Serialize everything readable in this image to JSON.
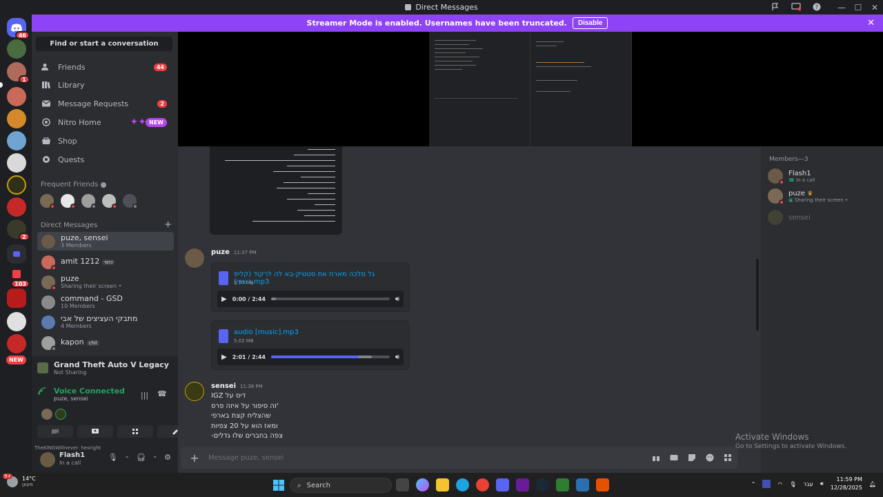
{
  "window": {
    "title": "Direct Messages",
    "controls": [
      "—",
      "☐",
      "✕"
    ]
  },
  "banner": {
    "text": "Streamer Mode is enabled. Usernames have been truncated.",
    "button": "Disable",
    "close": "✕"
  },
  "servers": {
    "badges": [
      "46",
      "1",
      "2",
      "103"
    ],
    "new_label": "NEW"
  },
  "dm_panel": {
    "find": "Find or start a conversation",
    "nav": [
      {
        "label": "Friends",
        "badge": "44"
      },
      {
        "label": "Library",
        "badge": ""
      },
      {
        "label": "Message Requests",
        "badge": "2"
      },
      {
        "label": "Nitro Home",
        "pill": "NEW"
      },
      {
        "label": "Shop",
        "badge": ""
      },
      {
        "label": "Quests",
        "badge": ""
      }
    ],
    "frequent_friends": "Frequent Friends",
    "direct_messages": "Direct Messages",
    "add": "+",
    "dms": [
      {
        "name": "puze, sensei",
        "sub": "3 Members"
      },
      {
        "name": "amit 1212",
        "tag": "כושי",
        "sub": ""
      },
      {
        "name": "puze",
        "sub": "Sharing their screen •"
      },
      {
        "name": "command - GSD",
        "sub": "10 Members"
      },
      {
        "name": "מתבקי העציצים של אבי",
        "sub": "4 Members"
      },
      {
        "name": "kapon",
        "tag": "chil",
        "sub": ""
      }
    ]
  },
  "activity": {
    "game": "Grand Theft Auto V Legacy",
    "game_sub": "Not Sharing",
    "voice_title": "Voice Connected",
    "voice_sub": "puze, sensei"
  },
  "user": {
    "ticker": "TheKINGWillnever: hesright",
    "name": "Flash1",
    "status": "In a call"
  },
  "chat": {
    "messages": [
      {
        "author": "puze",
        "time": "11:37 PM",
        "files": [
          {
            "name": "גל מלכה מארח את סטטיק-בא לה לרקוד (קליפ רשמי).mp3",
            "size": "3.77 MB",
            "time": "0:00 / 2:44",
            "progress": 0.0,
            "buffered": 0.04
          },
          {
            "name": "audio [music].mp3",
            "size": "5.02 MB",
            "time": "2:01 / 2:44",
            "progress": 0.74,
            "buffered": 0.85
          }
        ]
      },
      {
        "author": "sensei",
        "time": "11:38 PM",
        "lines": [
          "IGZ דיס על",
          "זה סיפור על איזה פרס'",
          "שהצליח קצת בארפי",
          "ומאז הוא על 20 צפיות",
          "-צפה בחברים שלו גדלים"
        ]
      }
    ],
    "composer_placeholder": "Message puze, sensei"
  },
  "members": {
    "header": "Members—3",
    "list": [
      {
        "name": "Flash1",
        "sub": "In a call"
      },
      {
        "name": "puze",
        "sub": "Sharing their screen •"
      },
      {
        "name": "sensei",
        "sub": ""
      }
    ]
  },
  "watermark": {
    "line1": "Activate Windows",
    "line2": "Go to Settings to activate Windows."
  },
  "taskbar": {
    "temp": "14°C",
    "weather_sub": "מעונן",
    "search": "Search",
    "lang": "עבר",
    "time": "11:59 PM",
    "date": "12/28/2025",
    "weather_badge": "9+"
  },
  "colors": {
    "accent": "#5865f2",
    "banner": "#8e44f6",
    "online": "#23a55a",
    "dnd": "#f23f43"
  }
}
